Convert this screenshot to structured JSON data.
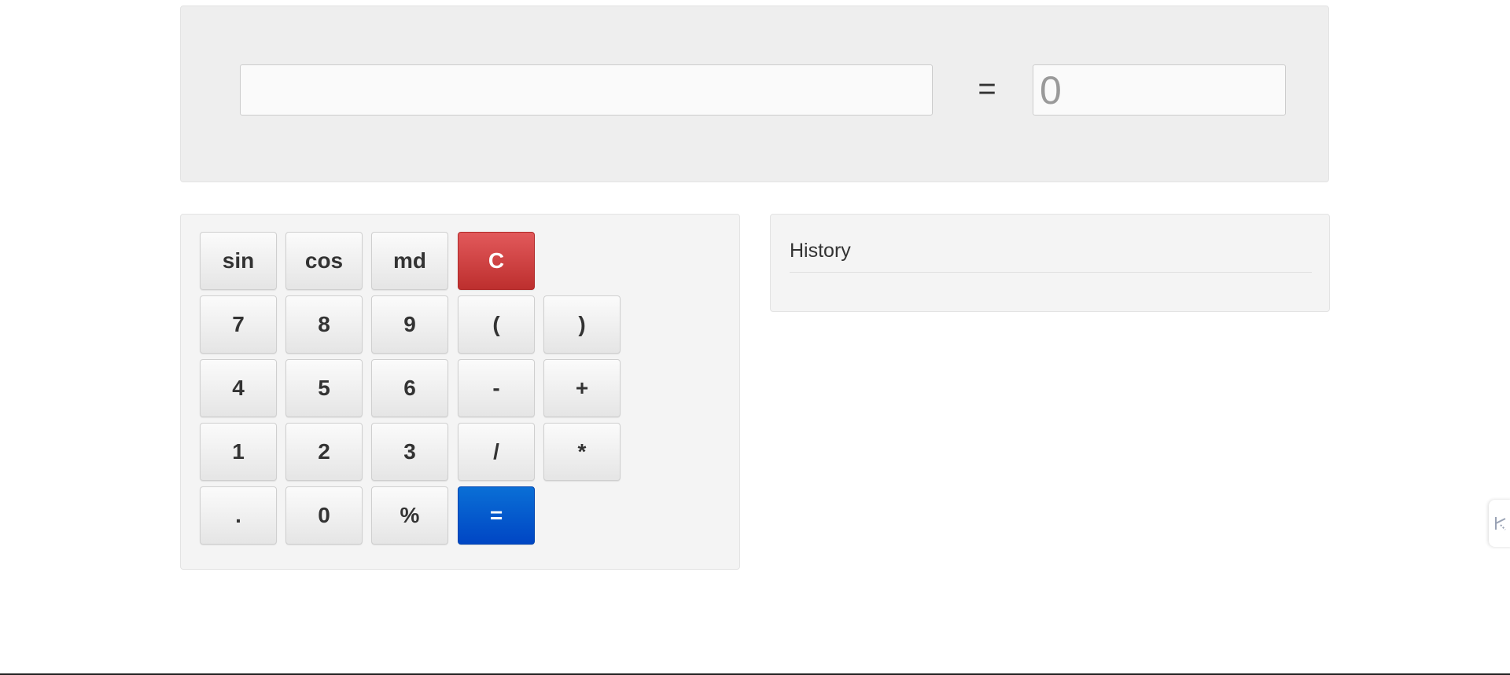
{
  "expression": {
    "value": "",
    "placeholder": ""
  },
  "equals_sign": "=",
  "result": {
    "value": "",
    "placeholder": "0"
  },
  "keypad": {
    "sin": "sin",
    "cos": "cos",
    "md": "md",
    "clear": "C",
    "seven": "7",
    "eight": "8",
    "nine": "9",
    "open_paren": "(",
    "close_paren": ")",
    "four": "4",
    "five": "5",
    "six": "6",
    "minus": "-",
    "plus": "+",
    "one": "1",
    "two": "2",
    "three": "3",
    "divide": "/",
    "multiply": "*",
    "dot": ".",
    "zero": "0",
    "percent": "%",
    "equals": "="
  },
  "history": {
    "title": "History",
    "items": []
  },
  "colors": {
    "clear_button": "#c9393a",
    "equals_button": "#0054c8",
    "panel_background": "#eeeeee"
  },
  "icons": {
    "side_tab": "extension-tab-icon"
  }
}
